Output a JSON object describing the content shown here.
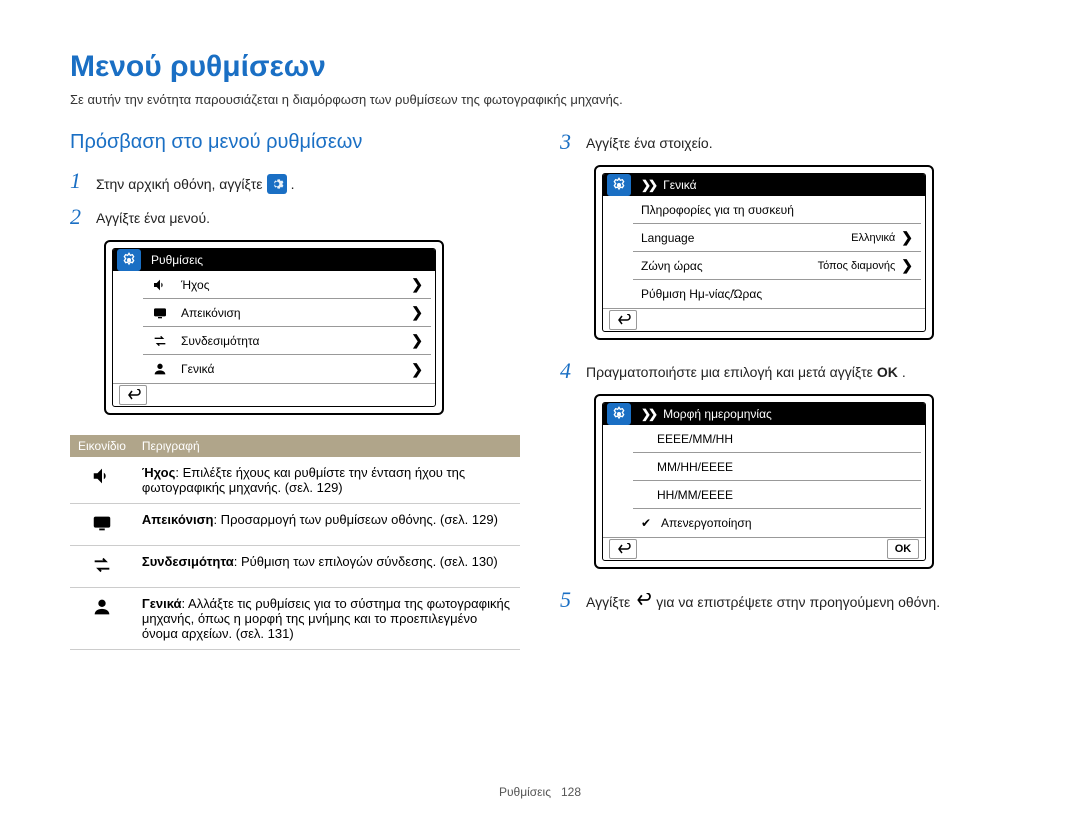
{
  "page": {
    "title": "Μενού ρυθμίσεων",
    "subtitle": "Σε αυτήν την ενότητα παρουσιάζεται η διαμόρφωση των ρυθμίσεων της φωτογραφικής μηχανής.",
    "section_heading": "Πρόσβαση στο μενού ρυθμίσεων",
    "footer_label": "Ρυθμίσεις",
    "footer_page": "128"
  },
  "steps": {
    "s1_pre": "Στην αρχική οθόνη, αγγίξτε ",
    "s1_post": ".",
    "s2": "Αγγίξτε ένα μενού.",
    "s3": "Αγγίξτε ένα στοιχείο.",
    "s4_pre": "Πραγματοποιήστε μια επιλογή και μετά αγγίξτε ",
    "s4_ok": "OK",
    "s4_post": ".",
    "s5_pre": "Αγγίξτε ",
    "s5_post": " για να επιστρέψετε στην προηγούμενη οθόνη."
  },
  "device1": {
    "title": "Ρυθμίσεις",
    "items": [
      {
        "label": "Ήχος"
      },
      {
        "label": "Απεικόνιση"
      },
      {
        "label": "Συνδεσιμότητα"
      },
      {
        "label": "Γενικά"
      }
    ]
  },
  "device2": {
    "title": "Γενικά",
    "row1": "Πληροφορίες για τη συσκευή",
    "row2_label": "Language",
    "row2_value": "Ελληνικά",
    "row3_label": "Ζώνη ώρας",
    "row3_value": "Τόπος διαμονής",
    "row4": "Ρύθμιση Ημ-νίας/Ώρας"
  },
  "device3": {
    "title": "Μορφή ημερομηνίας",
    "options": [
      "ΕΕΕΕ/ΜΜ/ΗΗ",
      "ΜΜ/ΗΗ/ΕΕΕΕ",
      "ΗΗ/ΜΜ/ΕΕΕΕ",
      "Απενεργοποίηση"
    ],
    "ok": "OK"
  },
  "table": {
    "col_icon": "Εικονίδιο",
    "col_desc": "Περιγραφή",
    "rows": [
      {
        "bold": "Ήχος",
        "text": ": Επιλέξτε ήχους και ρυθμίστε την ένταση ήχου της φωτογραφικής μηχανής. (σελ. 129)"
      },
      {
        "bold": "Απεικόνιση",
        "text": ": Προσαρμογή των ρυθμίσεων οθόνης. (σελ. 129)"
      },
      {
        "bold": "Συνδεσιμότητα",
        "text": ": Ρύθμιση των επιλογών σύνδεσης. (σελ. 130)"
      },
      {
        "bold": "Γενικά",
        "text": ": Αλλάξτε τις ρυθμίσεις για το σύστημα της φωτογραφικής μηχανής, όπως η μορφή της μνήμης και το προεπιλεγμένο όνομα αρχείων. (σελ. 131)"
      }
    ]
  }
}
